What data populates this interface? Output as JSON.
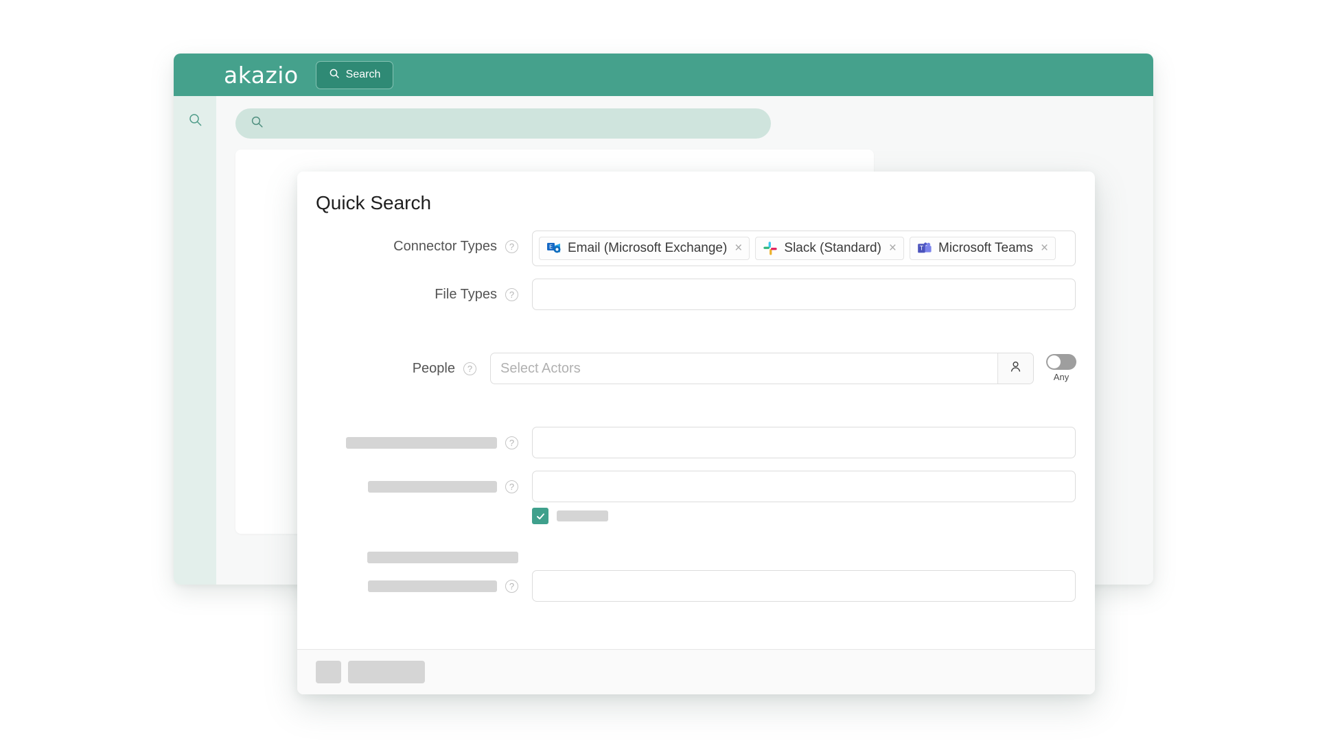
{
  "app": {
    "brand": "akazio",
    "nav": {
      "search_label": "Search",
      "search_icon": "magnifier-icon"
    },
    "sidebar": {
      "search_icon": "magnifier-icon"
    },
    "searchbar": {
      "icon": "magnifier-icon",
      "value": ""
    }
  },
  "dialog": {
    "title": "Quick Search",
    "help_icon_glyph": "?",
    "fields": {
      "connector_types": {
        "label": "Connector Types",
        "chips": [
          {
            "label": "Email (Microsoft Exchange)",
            "icon": "microsoft-exchange-icon",
            "remove_glyph": "×"
          },
          {
            "label": "Slack (Standard)",
            "icon": "slack-icon",
            "remove_glyph": "×"
          },
          {
            "label": "Microsoft Teams",
            "icon": "microsoft-teams-icon",
            "remove_glyph": "×"
          }
        ]
      },
      "file_types": {
        "label": "File Types",
        "value": ""
      },
      "people": {
        "label": "People",
        "placeholder": "Select Actors",
        "value": "",
        "picker_icon": "person-icon",
        "toggle": {
          "label": "Any",
          "state": "off"
        }
      }
    },
    "checkbox": {
      "checked": true,
      "check_glyph": "✓"
    }
  },
  "colors": {
    "brand_teal": "#45a18c",
    "nav_button_teal": "#2f8a75",
    "sidebar_mint": "#e3efeb",
    "searchbar_mint": "#cfe4dd",
    "checkbox_green": "#3fa08c",
    "toggle_grey": "#9e9e9e",
    "skeleton_grey": "#d5d5d5"
  }
}
